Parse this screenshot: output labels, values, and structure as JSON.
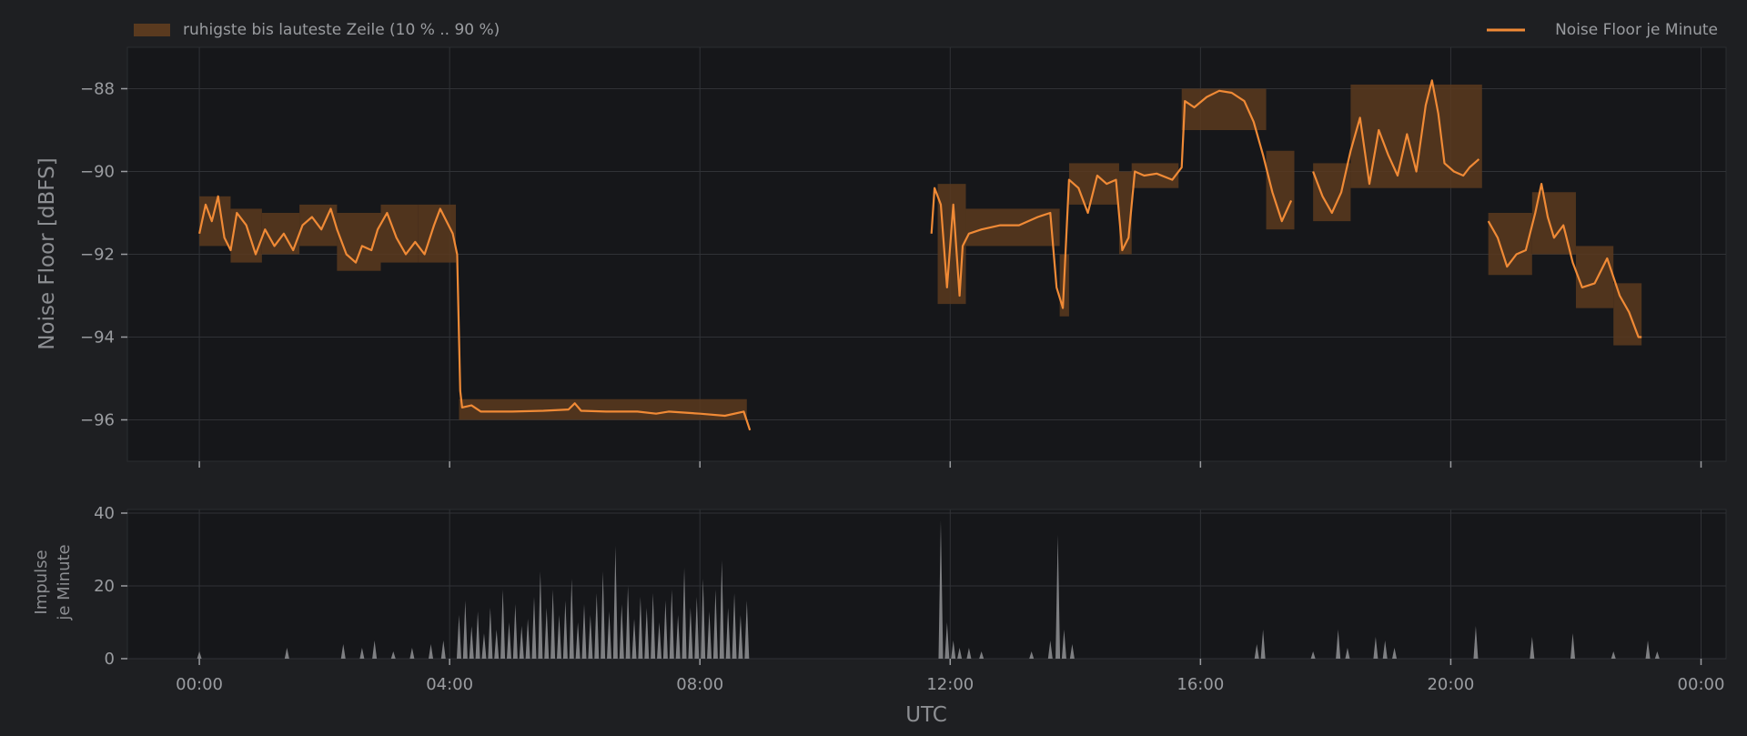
{
  "colors": {
    "background": "#1e1f22",
    "plot_background": "#16171a",
    "grid": "#303236",
    "axis_text": "#9a9ca0",
    "line": "#f08a36",
    "band": "#5a3a1f",
    "impulse": "#8a8b8e"
  },
  "chart_data": [
    {
      "type": "line",
      "ylabel": "Noise Floor [dBFS]",
      "ylim": [
        -97,
        -87
      ],
      "y_ticks": [
        -88,
        -90,
        -92,
        -94,
        -96
      ],
      "y_tick_labels": [
        "−88",
        "−90",
        "−92",
        "−94",
        "−96"
      ],
      "x_range_hours": [
        -1.15,
        24.4
      ],
      "grid": true,
      "legend_position": "top",
      "legend": {
        "band_label": "ruhigste bis lauteste Zeile (10 % .. 90 %)",
        "line_label": "Noise Floor je Minute"
      },
      "series": [
        {
          "name": "Noise Floor je Minute",
          "segments": [
            [
              [
                0.0,
                -91.5
              ],
              [
                0.1,
                -90.8
              ],
              [
                0.2,
                -91.2
              ],
              [
                0.3,
                -90.6
              ],
              [
                0.4,
                -91.6
              ],
              [
                0.5,
                -91.9
              ],
              [
                0.6,
                -91.0
              ],
              [
                0.75,
                -91.3
              ],
              [
                0.9,
                -92.0
              ],
              [
                1.05,
                -91.4
              ],
              [
                1.2,
                -91.8
              ],
              [
                1.35,
                -91.5
              ],
              [
                1.5,
                -91.9
              ],
              [
                1.65,
                -91.3
              ],
              [
                1.8,
                -91.1
              ],
              [
                1.95,
                -91.4
              ],
              [
                2.1,
                -90.9
              ],
              [
                2.2,
                -91.4
              ],
              [
                2.35,
                -92.0
              ],
              [
                2.5,
                -92.2
              ],
              [
                2.6,
                -91.8
              ],
              [
                2.75,
                -91.9
              ],
              [
                2.85,
                -91.4
              ],
              [
                3.0,
                -91.0
              ],
              [
                3.15,
                -91.6
              ],
              [
                3.3,
                -92.0
              ],
              [
                3.45,
                -91.7
              ],
              [
                3.6,
                -92.0
              ],
              [
                3.75,
                -91.3
              ],
              [
                3.85,
                -90.9
              ],
              [
                3.95,
                -91.2
              ],
              [
                4.05,
                -91.5
              ],
              [
                4.12,
                -92.0
              ],
              [
                4.17,
                -95.3
              ],
              [
                4.2,
                -95.7
              ],
              [
                4.35,
                -95.65
              ],
              [
                4.5,
                -95.8
              ],
              [
                5.0,
                -95.8
              ],
              [
                5.5,
                -95.78
              ],
              [
                5.9,
                -95.75
              ],
              [
                6.0,
                -95.6
              ],
              [
                6.1,
                -95.78
              ],
              [
                6.5,
                -95.8
              ],
              [
                7.0,
                -95.8
              ],
              [
                7.3,
                -95.85
              ],
              [
                7.5,
                -95.8
              ],
              [
                8.0,
                -95.85
              ],
              [
                8.4,
                -95.9
              ],
              [
                8.7,
                -95.8
              ],
              [
                8.8,
                -96.25
              ]
            ],
            [
              [
                11.7,
                -91.5
              ],
              [
                11.75,
                -90.4
              ],
              [
                11.85,
                -90.8
              ],
              [
                11.95,
                -92.8
              ],
              [
                12.05,
                -90.8
              ],
              [
                12.15,
                -93.0
              ],
              [
                12.2,
                -91.8
              ],
              [
                12.3,
                -91.5
              ],
              [
                12.5,
                -91.4
              ],
              [
                12.8,
                -91.3
              ],
              [
                13.1,
                -91.3
              ],
              [
                13.4,
                -91.1
              ],
              [
                13.6,
                -91.0
              ],
              [
                13.7,
                -92.8
              ],
              [
                13.8,
                -93.3
              ],
              [
                13.9,
                -90.2
              ],
              [
                14.05,
                -90.4
              ],
              [
                14.2,
                -91.0
              ],
              [
                14.35,
                -90.1
              ],
              [
                14.5,
                -90.3
              ],
              [
                14.65,
                -90.2
              ],
              [
                14.75,
                -91.9
              ],
              [
                14.85,
                -91.6
              ],
              [
                14.95,
                -90.0
              ],
              [
                15.1,
                -90.1
              ],
              [
                15.3,
                -90.05
              ],
              [
                15.55,
                -90.2
              ],
              [
                15.7,
                -89.9
              ],
              [
                15.75,
                -88.3
              ],
              [
                15.9,
                -88.45
              ],
              [
                16.1,
                -88.2
              ],
              [
                16.3,
                -88.05
              ],
              [
                16.5,
                -88.1
              ],
              [
                16.7,
                -88.3
              ],
              [
                16.85,
                -88.8
              ],
              [
                17.0,
                -89.6
              ],
              [
                17.15,
                -90.5
              ],
              [
                17.3,
                -91.2
              ],
              [
                17.45,
                -90.7
              ]
            ],
            [
              [
                17.8,
                -90.0
              ],
              [
                17.95,
                -90.6
              ],
              [
                18.1,
                -91.0
              ],
              [
                18.25,
                -90.5
              ],
              [
                18.4,
                -89.5
              ],
              [
                18.55,
                -88.7
              ],
              [
                18.7,
                -90.3
              ],
              [
                18.85,
                -89.0
              ],
              [
                19.0,
                -89.6
              ],
              [
                19.15,
                -90.1
              ],
              [
                19.3,
                -89.1
              ],
              [
                19.45,
                -90.0
              ],
              [
                19.6,
                -88.4
              ],
              [
                19.7,
                -87.8
              ],
              [
                19.8,
                -88.6
              ],
              [
                19.9,
                -89.8
              ],
              [
                20.05,
                -90.0
              ],
              [
                20.2,
                -90.1
              ],
              [
                20.3,
                -89.9
              ],
              [
                20.45,
                -89.7
              ]
            ],
            [
              [
                20.6,
                -91.2
              ],
              [
                20.75,
                -91.6
              ],
              [
                20.9,
                -92.3
              ],
              [
                21.05,
                -92.0
              ],
              [
                21.2,
                -91.9
              ],
              [
                21.35,
                -91.0
              ],
              [
                21.45,
                -90.3
              ],
              [
                21.55,
                -91.1
              ],
              [
                21.65,
                -91.6
              ],
              [
                21.8,
                -91.3
              ],
              [
                21.95,
                -92.2
              ],
              [
                22.1,
                -92.8
              ],
              [
                22.3,
                -92.7
              ],
              [
                22.5,
                -92.1
              ],
              [
                22.7,
                -93.0
              ],
              [
                22.85,
                -93.4
              ],
              [
                23.0,
                -94.0
              ],
              [
                23.05,
                -94.0
              ]
            ]
          ]
        },
        {
          "name": "ruhigste bis lauteste Zeile (10 % .. 90 %)",
          "bands": [
            [
              0.0,
              0.5,
              -91.8,
              -90.6
            ],
            [
              0.5,
              1.0,
              -92.2,
              -90.9
            ],
            [
              1.0,
              1.6,
              -92.0,
              -91.0
            ],
            [
              1.6,
              2.2,
              -91.8,
              -90.8
            ],
            [
              2.2,
              2.9,
              -92.4,
              -91.0
            ],
            [
              2.9,
              3.5,
              -92.2,
              -90.8
            ],
            [
              3.5,
              4.1,
              -92.2,
              -90.8
            ],
            [
              4.15,
              8.75,
              -96.0,
              -95.5
            ],
            [
              11.8,
              12.25,
              -93.2,
              -90.3
            ],
            [
              12.25,
              13.75,
              -91.8,
              -90.9
            ],
            [
              13.75,
              13.9,
              -93.5,
              -92.0
            ],
            [
              13.9,
              14.7,
              -90.8,
              -89.8
            ],
            [
              14.7,
              14.9,
              -92.0,
              -90.0
            ],
            [
              14.9,
              15.65,
              -90.4,
              -89.8
            ],
            [
              15.7,
              17.05,
              -89.0,
              -88.0
            ],
            [
              17.05,
              17.5,
              -91.4,
              -89.5
            ],
            [
              17.8,
              18.4,
              -91.2,
              -89.8
            ],
            [
              18.4,
              20.5,
              -90.4,
              -87.9
            ],
            [
              20.6,
              21.3,
              -92.5,
              -91.0
            ],
            [
              21.3,
              22.0,
              -92.0,
              -90.5
            ],
            [
              22.0,
              22.6,
              -93.3,
              -91.8
            ],
            [
              22.6,
              23.05,
              -94.2,
              -92.7
            ]
          ]
        }
      ]
    },
    {
      "type": "area",
      "ylabel": "Impulse\nje Minute",
      "ylabel_lines": [
        "Impulse",
        "je Minute"
      ],
      "ylim": [
        0,
        41
      ],
      "y_ticks": [
        0,
        20,
        40
      ],
      "y_tick_labels": [
        "0",
        "20",
        "40"
      ],
      "xlabel": "UTC",
      "x_range_hours": [
        -1.15,
        24.4
      ],
      "x_ticks_hours": [
        0,
        4,
        8,
        12,
        16,
        20,
        24
      ],
      "x_tick_labels": [
        "00:00",
        "04:00",
        "08:00",
        "12:00",
        "16:00",
        "20:00",
        "00:00"
      ],
      "grid": true,
      "series": [
        {
          "name": "Impulse je Minute",
          "spikes": [
            [
              0.0,
              2
            ],
            [
              1.4,
              3
            ],
            [
              2.3,
              4
            ],
            [
              2.6,
              3
            ],
            [
              2.8,
              5
            ],
            [
              3.1,
              2
            ],
            [
              3.4,
              3
            ],
            [
              3.7,
              4
            ],
            [
              3.9,
              5
            ],
            [
              4.15,
              12
            ],
            [
              4.25,
              16
            ],
            [
              4.35,
              9
            ],
            [
              4.45,
              13
            ],
            [
              4.55,
              7
            ],
            [
              4.65,
              14
            ],
            [
              4.75,
              8
            ],
            [
              4.85,
              19
            ],
            [
              4.95,
              10
            ],
            [
              5.05,
              15
            ],
            [
              5.15,
              9
            ],
            [
              5.25,
              11
            ],
            [
              5.35,
              17
            ],
            [
              5.45,
              24
            ],
            [
              5.55,
              14
            ],
            [
              5.65,
              19
            ],
            [
              5.75,
              12
            ],
            [
              5.85,
              16
            ],
            [
              5.95,
              22
            ],
            [
              6.05,
              10
            ],
            [
              6.15,
              15
            ],
            [
              6.25,
              12
            ],
            [
              6.35,
              18
            ],
            [
              6.45,
              24
            ],
            [
              6.55,
              13
            ],
            [
              6.65,
              31
            ],
            [
              6.75,
              15
            ],
            [
              6.85,
              20
            ],
            [
              6.95,
              11
            ],
            [
              7.05,
              17
            ],
            [
              7.15,
              14
            ],
            [
              7.25,
              18
            ],
            [
              7.35,
              10
            ],
            [
              7.45,
              16
            ],
            [
              7.55,
              19
            ],
            [
              7.65,
              12
            ],
            [
              7.75,
              25
            ],
            [
              7.85,
              14
            ],
            [
              7.95,
              17
            ],
            [
              8.05,
              22
            ],
            [
              8.15,
              13
            ],
            [
              8.25,
              19
            ],
            [
              8.35,
              27
            ],
            [
              8.45,
              14
            ],
            [
              8.55,
              18
            ],
            [
              8.65,
              12
            ],
            [
              8.75,
              16
            ],
            [
              11.85,
              38
            ],
            [
              11.95,
              10
            ],
            [
              12.05,
              5
            ],
            [
              12.15,
              3
            ],
            [
              12.3,
              3
            ],
            [
              12.5,
              2
            ],
            [
              13.3,
              2
            ],
            [
              13.6,
              5
            ],
            [
              13.72,
              34
            ],
            [
              13.82,
              8
            ],
            [
              13.95,
              4
            ],
            [
              16.9,
              4
            ],
            [
              17.0,
              8
            ],
            [
              17.8,
              2
            ],
            [
              18.2,
              8
            ],
            [
              18.35,
              3
            ],
            [
              18.8,
              6
            ],
            [
              18.95,
              5
            ],
            [
              19.1,
              3
            ],
            [
              20.4,
              9
            ],
            [
              21.3,
              6
            ],
            [
              21.95,
              7
            ],
            [
              22.6,
              2
            ],
            [
              23.15,
              5
            ],
            [
              23.3,
              2
            ]
          ]
        }
      ]
    }
  ]
}
